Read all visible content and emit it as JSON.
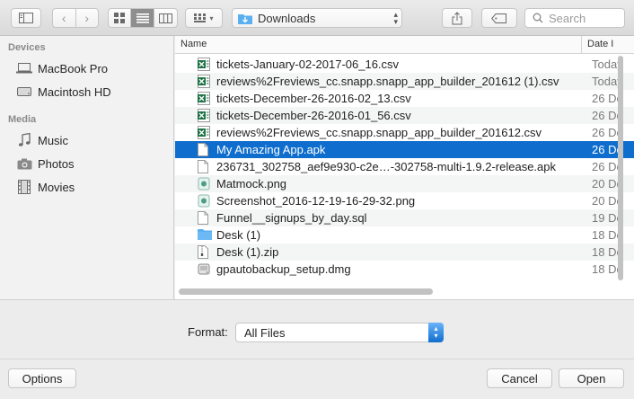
{
  "toolbar": {
    "location": "Downloads",
    "search_placeholder": "Search"
  },
  "sidebar": {
    "sections": [
      {
        "title": "Devices",
        "items": [
          {
            "label": "MacBook Pro",
            "icon": "laptop-icon"
          },
          {
            "label": "Macintosh HD",
            "icon": "hard-drive-icon"
          }
        ]
      },
      {
        "title": "Media",
        "items": [
          {
            "label": "Music",
            "icon": "music-icon"
          },
          {
            "label": "Photos",
            "icon": "camera-icon"
          },
          {
            "label": "Movies",
            "icon": "film-icon"
          }
        ]
      }
    ]
  },
  "filelist": {
    "columns": {
      "name": "Name",
      "date": "Date I"
    },
    "rows": [
      {
        "name": "tickets-January-02-2017-06_16.csv",
        "date": "Today",
        "icon": "csv-icon"
      },
      {
        "name": "reviews%2Freviews_cc.snapp.snapp_app_builder_201612 (1).csv",
        "date": "Today",
        "icon": "csv-icon"
      },
      {
        "name": "tickets-December-26-2016-02_13.csv",
        "date": "26 De",
        "icon": "csv-icon"
      },
      {
        "name": "tickets-December-26-2016-01_56.csv",
        "date": "26 De",
        "icon": "csv-icon"
      },
      {
        "name": "reviews%2Freviews_cc.snapp.snapp_app_builder_201612.csv",
        "date": "26 De",
        "icon": "csv-icon"
      },
      {
        "name": "My Amazing App.apk",
        "date": "26 De",
        "icon": "document-icon",
        "selected": true
      },
      {
        "name": "236731_302758_aef9e930-c2e…-302758-multi-1.9.2-release.apk",
        "date": "26 De",
        "icon": "document-icon"
      },
      {
        "name": "Matmock.png",
        "date": "20 De",
        "icon": "image-icon"
      },
      {
        "name": "Screenshot_2016-12-19-16-29-32.png",
        "date": "20 De",
        "icon": "image-icon"
      },
      {
        "name": "Funnel__signups_by_day.sql",
        "date": "19 De",
        "icon": "document-icon"
      },
      {
        "name": "Desk (1)",
        "date": "18 De",
        "icon": "folder-icon"
      },
      {
        "name": "Desk (1).zip",
        "date": "18 De",
        "icon": "zip-icon"
      },
      {
        "name": "gpautobackup_setup.dmg",
        "date": "18 De",
        "icon": "disk-image-icon"
      }
    ]
  },
  "bottom": {
    "format_label": "Format:",
    "format_value": "All Files",
    "options_label": "Options",
    "cancel_label": "Cancel",
    "open_label": "Open"
  },
  "colors": {
    "selection": "#0f6ecd",
    "csv_green": "#1e7145",
    "folder_blue": "#5aaff0"
  }
}
